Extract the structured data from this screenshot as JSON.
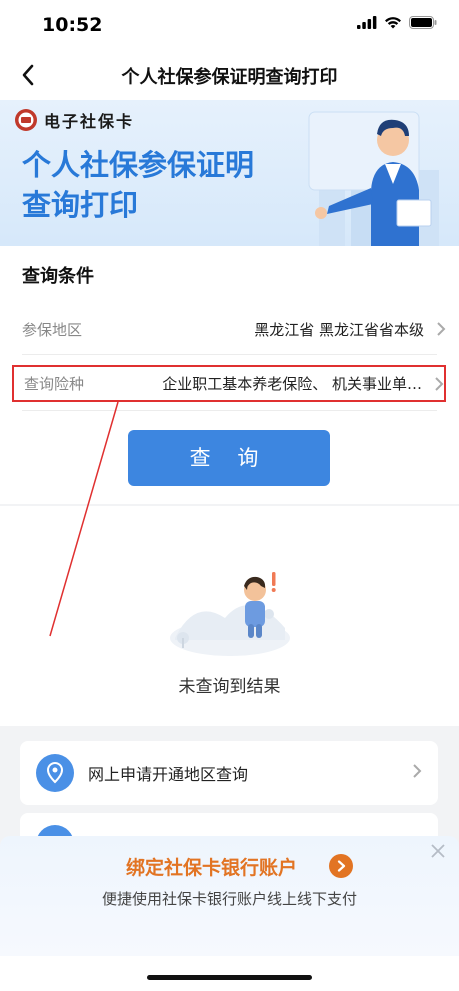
{
  "status_bar": {
    "time": "10:52"
  },
  "nav": {
    "title": "个人社保参保证明查询打印"
  },
  "banner": {
    "logo_text": "电子社保卡",
    "title_line1": "个人社保参保证明",
    "title_line2": "查询打印"
  },
  "form": {
    "section_title": "查询条件",
    "region_label": "参保地区",
    "region_value": "黑龙江省 黑龙江省省本级",
    "type_label": "查询险种",
    "type_value": "企业职工基本养老保险、 机关事业单…",
    "query_button": "查 询"
  },
  "empty_state": {
    "text": "未查询到结果"
  },
  "list": {
    "item1_label": "网上申请开通地区查询"
  },
  "promo": {
    "title": "绑定社保卡银行账户",
    "subtitle": "便捷使用社保卡银行账户线上线下支付"
  },
  "colors": {
    "accent_blue": "#3d86e0",
    "title_blue": "#2879d8",
    "promo_orange": "#e27423",
    "highlight_red": "#e03030"
  },
  "icons": [
    "back-arrow-icon",
    "chevron-right-icon",
    "location-pin-icon",
    "close-icon",
    "arrow-right-icon",
    "signal-icon",
    "wifi-icon",
    "battery-icon"
  ]
}
